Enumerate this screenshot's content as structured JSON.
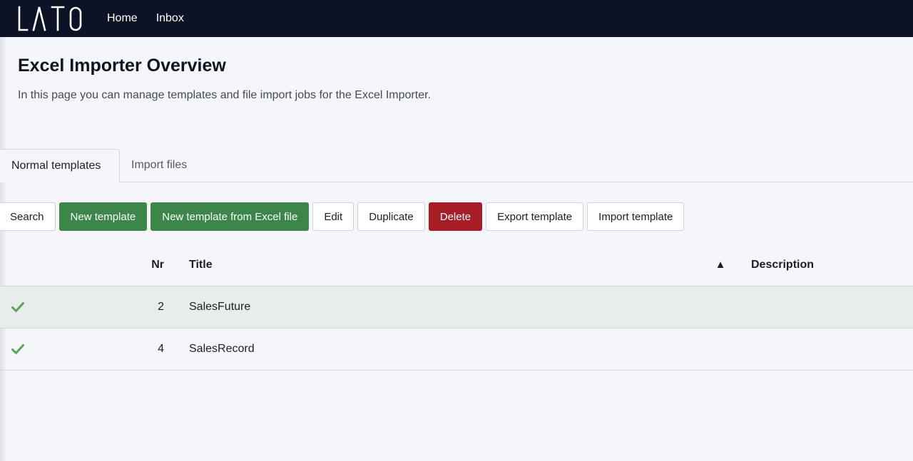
{
  "brand": {
    "logo_text": "LATO"
  },
  "nav": {
    "home": "Home",
    "inbox": "Inbox"
  },
  "header": {
    "title": "Excel Importer Overview",
    "subtitle": "In this page you can manage templates and file import jobs for the Excel Importer."
  },
  "tabs": [
    {
      "label": "Normal templates",
      "active": true
    },
    {
      "label": "Import files",
      "active": false
    }
  ],
  "toolbar": {
    "search": "Search",
    "new_template": "New template",
    "new_from_excel": "New template from Excel file",
    "edit": "Edit",
    "duplicate": "Duplicate",
    "delete": "Delete",
    "export_template": "Export template",
    "import_template": "Import template"
  },
  "table": {
    "columns": {
      "nr": "Nr",
      "title": "Title",
      "sort_indicator": "▲",
      "description": "Description"
    },
    "rows": [
      {
        "nr": "2",
        "title": "SalesFuture",
        "description": "",
        "checked": true,
        "selected": true
      },
      {
        "nr": "4",
        "title": "SalesRecord",
        "description": "",
        "checked": true,
        "selected": false
      }
    ]
  },
  "colors": {
    "topbar": "#0c1326",
    "primary_green": "#3a8749",
    "danger_red": "#a71d26",
    "check_green": "#5aa45a"
  },
  "icons": {
    "check": "check-icon",
    "sort": "sort-ascending-icon"
  }
}
